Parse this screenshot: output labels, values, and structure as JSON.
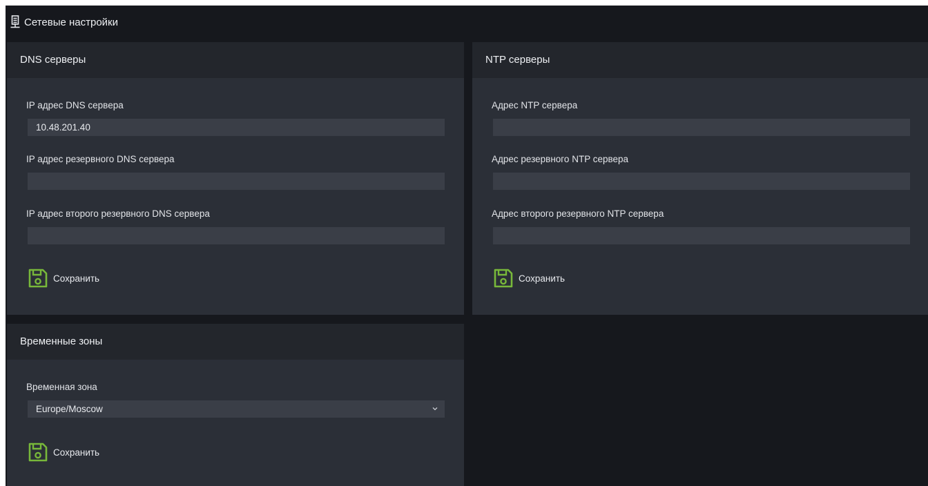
{
  "window": {
    "title": "Сетевые настройки",
    "icon": "server-icon"
  },
  "dns": {
    "header": "DNS серверы",
    "fields": [
      {
        "label": "IP адрес DNS сервера",
        "value": "10.48.201.40"
      },
      {
        "label": "IP адрес резервного DNS сервера",
        "value": ""
      },
      {
        "label": "IP адрес второго резервного DNS сервера",
        "value": ""
      }
    ],
    "save_label": "Сохранить"
  },
  "ntp": {
    "header": "NTP серверы",
    "fields": [
      {
        "label": "Адрес NTP сервера",
        "value": ""
      },
      {
        "label": "Адрес резервного NTP сервера",
        "value": ""
      },
      {
        "label": "Адрес второго резервного NTP сервера",
        "value": ""
      }
    ],
    "save_label": "Сохранить"
  },
  "timezone": {
    "header": "Временные зоны",
    "label": "Временная зона",
    "selected": "Europe/Moscow",
    "save_label": "Сохранить"
  },
  "colors": {
    "background": "#16181d",
    "panel": "#2b2f37",
    "panel_header": "#23262c",
    "input": "#3a3e47",
    "accent_green": "#78b83a"
  },
  "icons": {
    "save": "floppy-disk-icon",
    "dropdown": "chevron-down-icon"
  }
}
